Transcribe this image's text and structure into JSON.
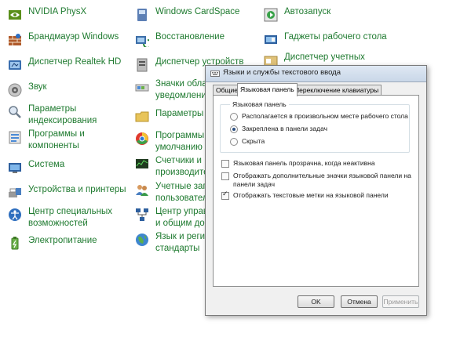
{
  "control_panel": {
    "items": [
      {
        "label": "NVIDIA PhysX",
        "icon": "nvidia-icon"
      },
      {
        "label": "Windows CardSpace",
        "icon": "cardspace-icon"
      },
      {
        "label": "Автозапуск",
        "icon": "autoplay-icon"
      },
      {
        "label": "Брандмауэр Windows",
        "icon": "firewall-icon"
      },
      {
        "label": "Восстановление",
        "icon": "recovery-icon"
      },
      {
        "label": "Гаджеты рабочего стола",
        "icon": "gadgets-icon"
      },
      {
        "label": "Диспетчер Realtek HD",
        "icon": "realtek-icon"
      },
      {
        "label": "Диспетчер устройств",
        "icon": "device-manager-icon"
      },
      {
        "label": "Диспетчер учетных",
        "icon": "credential-manager-icon"
      },
      {
        "label": "Звук",
        "icon": "sound-icon"
      },
      {
        "label": "Значки облас",
        "label2": "уведомлений",
        "icon": "notification-icons-icon"
      },
      {
        "label": "Параметры",
        "label2": "индексирования",
        "icon": "indexing-icon"
      },
      {
        "label": "Параметры п",
        "icon": "folder-options-icon"
      },
      {
        "label": "Программы и",
        "label2": "компоненты",
        "icon": "programs-icon"
      },
      {
        "label": "Программы",
        "label2": "умолчанию",
        "icon": "default-programs-icon"
      },
      {
        "label": "Система",
        "icon": "system-icon"
      },
      {
        "label": "Счетчики и",
        "label2": "производите",
        "icon": "performance-icon"
      },
      {
        "label": "Устройства и принтеры",
        "icon": "devices-printers-icon"
      },
      {
        "label": "Учетные запи",
        "label2": "пользовател",
        "icon": "user-accounts-icon"
      },
      {
        "label": "Центр специальных",
        "label2": "возможностей",
        "icon": "ease-of-access-icon"
      },
      {
        "label": "Центр управл",
        "label2": "и общим дос",
        "icon": "network-center-icon"
      },
      {
        "label": "Электропитание",
        "icon": "power-icon"
      },
      {
        "label": "Язык и регио",
        "label2": "стандарты",
        "icon": "region-language-icon"
      }
    ],
    "colors": {
      "link": "#1e7a2f"
    }
  },
  "dialog": {
    "title": "Языки и службы текстового ввода",
    "tabs": [
      "Общие",
      "Языковая панель",
      "Переключение клавиатуры"
    ],
    "active_tab": "Языковая панель",
    "group": {
      "label": "Языковая панель",
      "options": [
        {
          "label": "Располагается в произвольном месте рабочего стола",
          "checked": false
        },
        {
          "label": "Закреплена в панели задач",
          "checked": true
        },
        {
          "label": "Скрыта",
          "checked": false
        }
      ]
    },
    "checkboxes": [
      {
        "label": "Языковая панель прозрачна, когда неактивна",
        "checked": false
      },
      {
        "label": "Отображать дополнительные значки языковой панели на",
        "label2": "панели задач",
        "checked": false
      },
      {
        "label": "Отображать текстовые метки на языковой панели",
        "checked": true
      }
    ],
    "buttons": {
      "ok": "OK",
      "cancel": "Отмена",
      "apply": "Применить"
    }
  }
}
